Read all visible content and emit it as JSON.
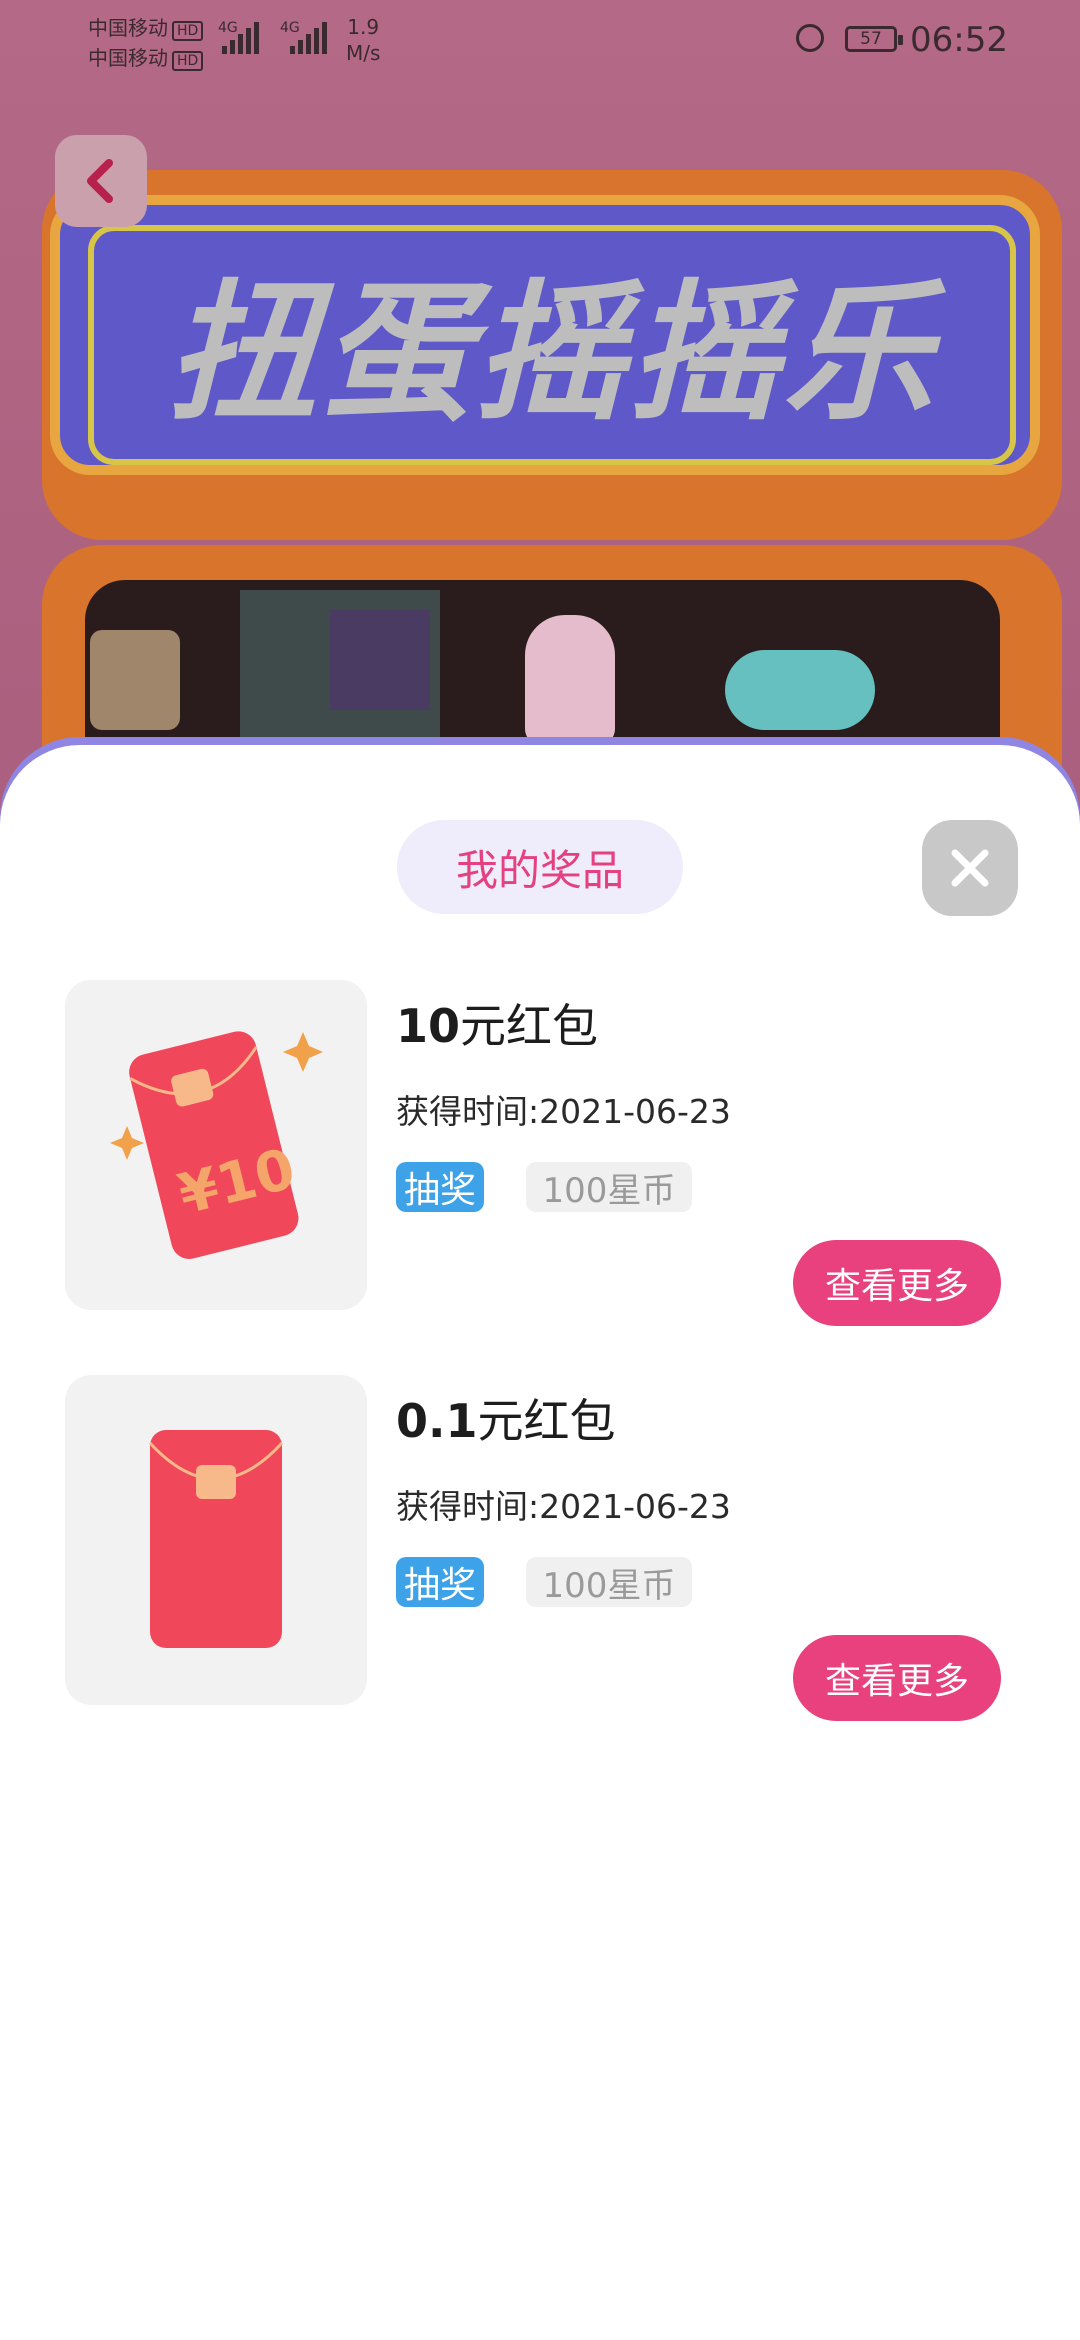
{
  "status_bar": {
    "carrier_1": "中国移动",
    "carrier_2": "中国移动",
    "hd_label": "HD",
    "signal_1": "4G",
    "signal_2": "4G",
    "net_speed_value": "1.9",
    "net_speed_unit": "M/s",
    "battery": "57",
    "time": "06:52"
  },
  "banner": {
    "title": "扭蛋摇摇乐"
  },
  "sheet": {
    "title": "我的奖品"
  },
  "prizes": [
    {
      "name_amount": "10",
      "name_suffix": "元红包",
      "time": "获得时间:2021-06-23",
      "tag": "抽奖",
      "cost": "100星币",
      "button": "查看更多",
      "image_label": "¥10"
    },
    {
      "name_amount": "0.1",
      "name_suffix": "元红包",
      "time": "获得时间:2021-06-23",
      "tag": "抽奖",
      "cost": "100星币",
      "button": "查看更多"
    }
  ],
  "colors": {
    "accent": "#e8417e",
    "tag_blue": "#3da2e8",
    "title_bg": "#efecfb",
    "envelope_red": "#f0475a"
  }
}
